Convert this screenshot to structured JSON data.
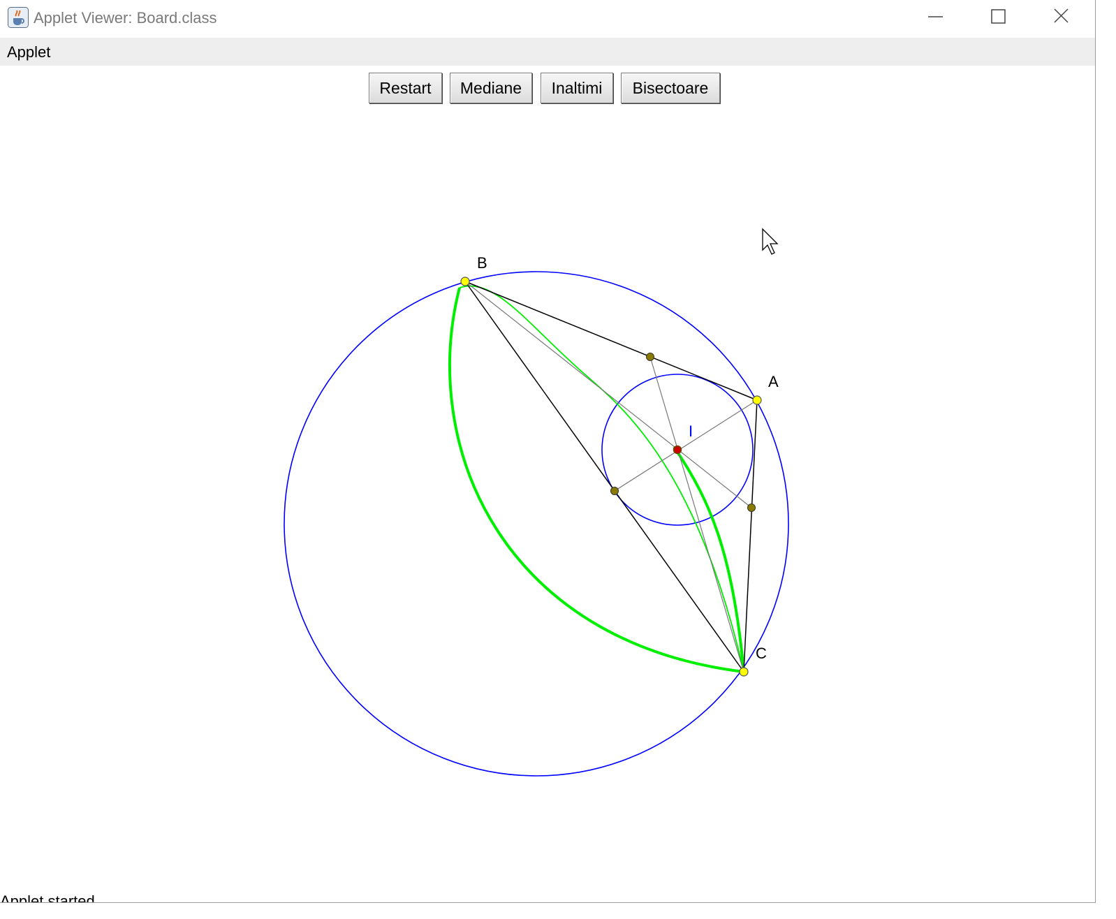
{
  "window": {
    "title": "Applet Viewer: Board.class"
  },
  "menubar": {
    "items": [
      {
        "label": "Applet"
      }
    ]
  },
  "toolbar": {
    "buttons": [
      {
        "label": "Restart"
      },
      {
        "label": "Mediane"
      },
      {
        "label": "Inaltimi"
      },
      {
        "label": "Bisectoare"
      }
    ]
  },
  "board": {
    "points": {
      "A": "A",
      "B": "B",
      "C": "C"
    },
    "incenter_label": "I"
  },
  "status": {
    "text": "Applet started."
  },
  "colors": {
    "circle": "#0000ff",
    "curve": "#00ee00",
    "triangle": "#000000",
    "vertex_fill": "#ffff00",
    "foot_fill": "#8b7a00",
    "incenter_fill": "#cc0000"
  },
  "icons": [
    "java-cup-icon",
    "minimize-icon",
    "maximize-icon",
    "close-icon",
    "mouse-cursor-icon"
  ]
}
